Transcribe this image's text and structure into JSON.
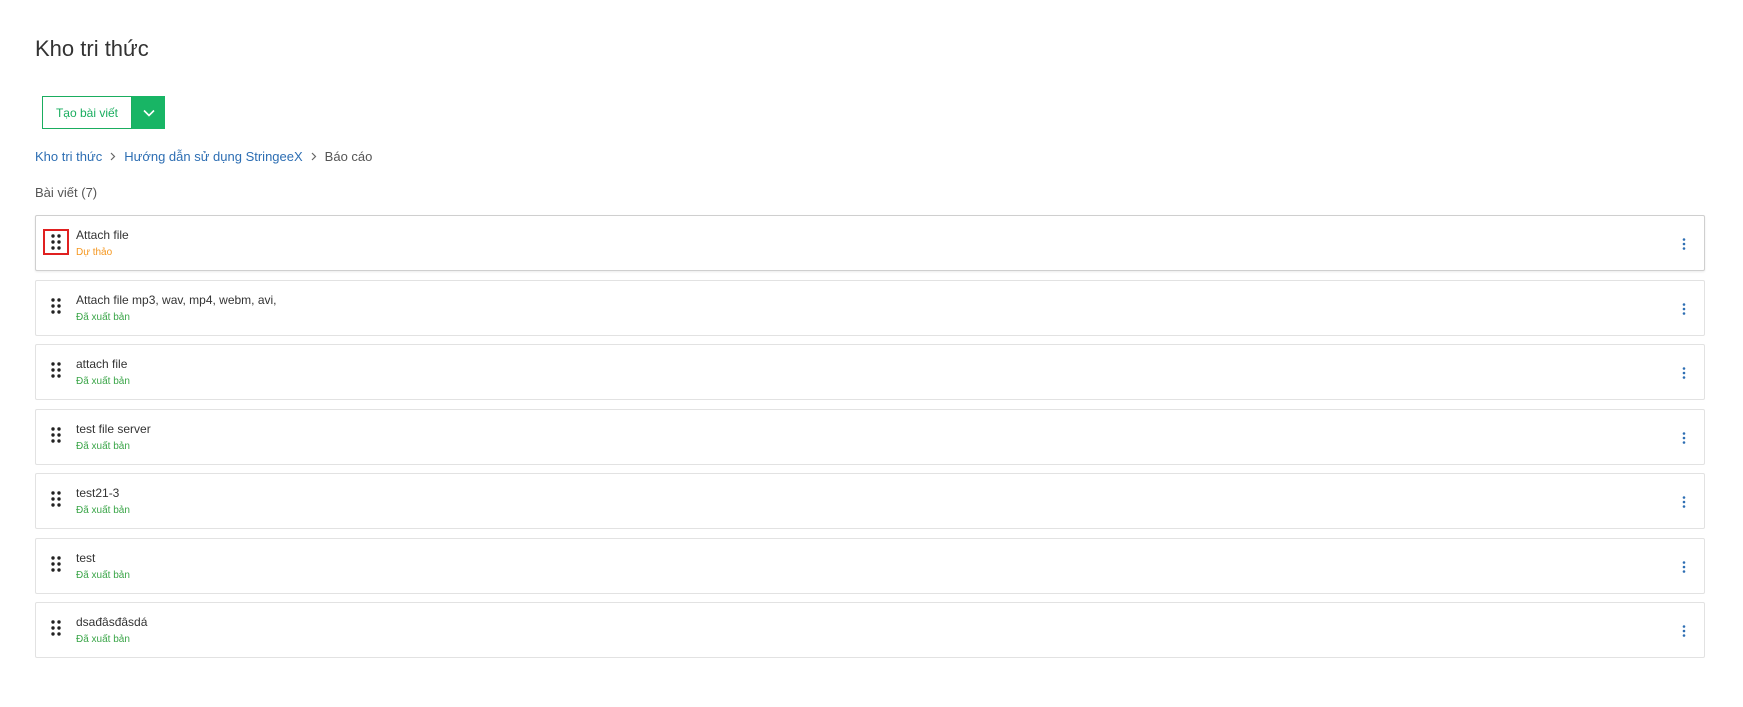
{
  "header": {
    "title": "Kho tri thức"
  },
  "toolbar": {
    "create_label": "Tạo bài viết"
  },
  "breadcrumb": [
    {
      "label": "Kho tri thức"
    },
    {
      "label": "Hướng dẫn sử dụng StringeeX"
    },
    {
      "label": "Báo cáo"
    }
  ],
  "articles_count_label": "Bài viết (7)",
  "articles": [
    {
      "title": "Attach file",
      "status": "Dự thảo",
      "status_type": "draft"
    },
    {
      "title": "Attach file mp3, wav, mp4, webm, avi,",
      "status": "Đã xuất bản",
      "status_type": "published"
    },
    {
      "title": "attach file",
      "status": "Đã xuất bản",
      "status_type": "published"
    },
    {
      "title": "test file server",
      "status": "Đã xuất bản",
      "status_type": "published"
    },
    {
      "title": "test21-3",
      "status": "Đã xuất bản",
      "status_type": "published"
    },
    {
      "title": "test",
      "status": "Đã xuất bản",
      "status_type": "published"
    },
    {
      "title": "dsađâsđâsdá",
      "status": "Đã xuất bản",
      "status_type": "published"
    }
  ],
  "icons": {
    "drag": "drag-handle-icon",
    "more": "more-vertical-icon",
    "dropdown": "chevron-down-icon",
    "separator": "chevron-right-icon"
  },
  "colors": {
    "brand_green": "#18b565",
    "link_blue": "#2d6eb3",
    "draft_orange": "#f5961e",
    "published_green": "#3aa548",
    "highlight_red": "#e02020"
  }
}
